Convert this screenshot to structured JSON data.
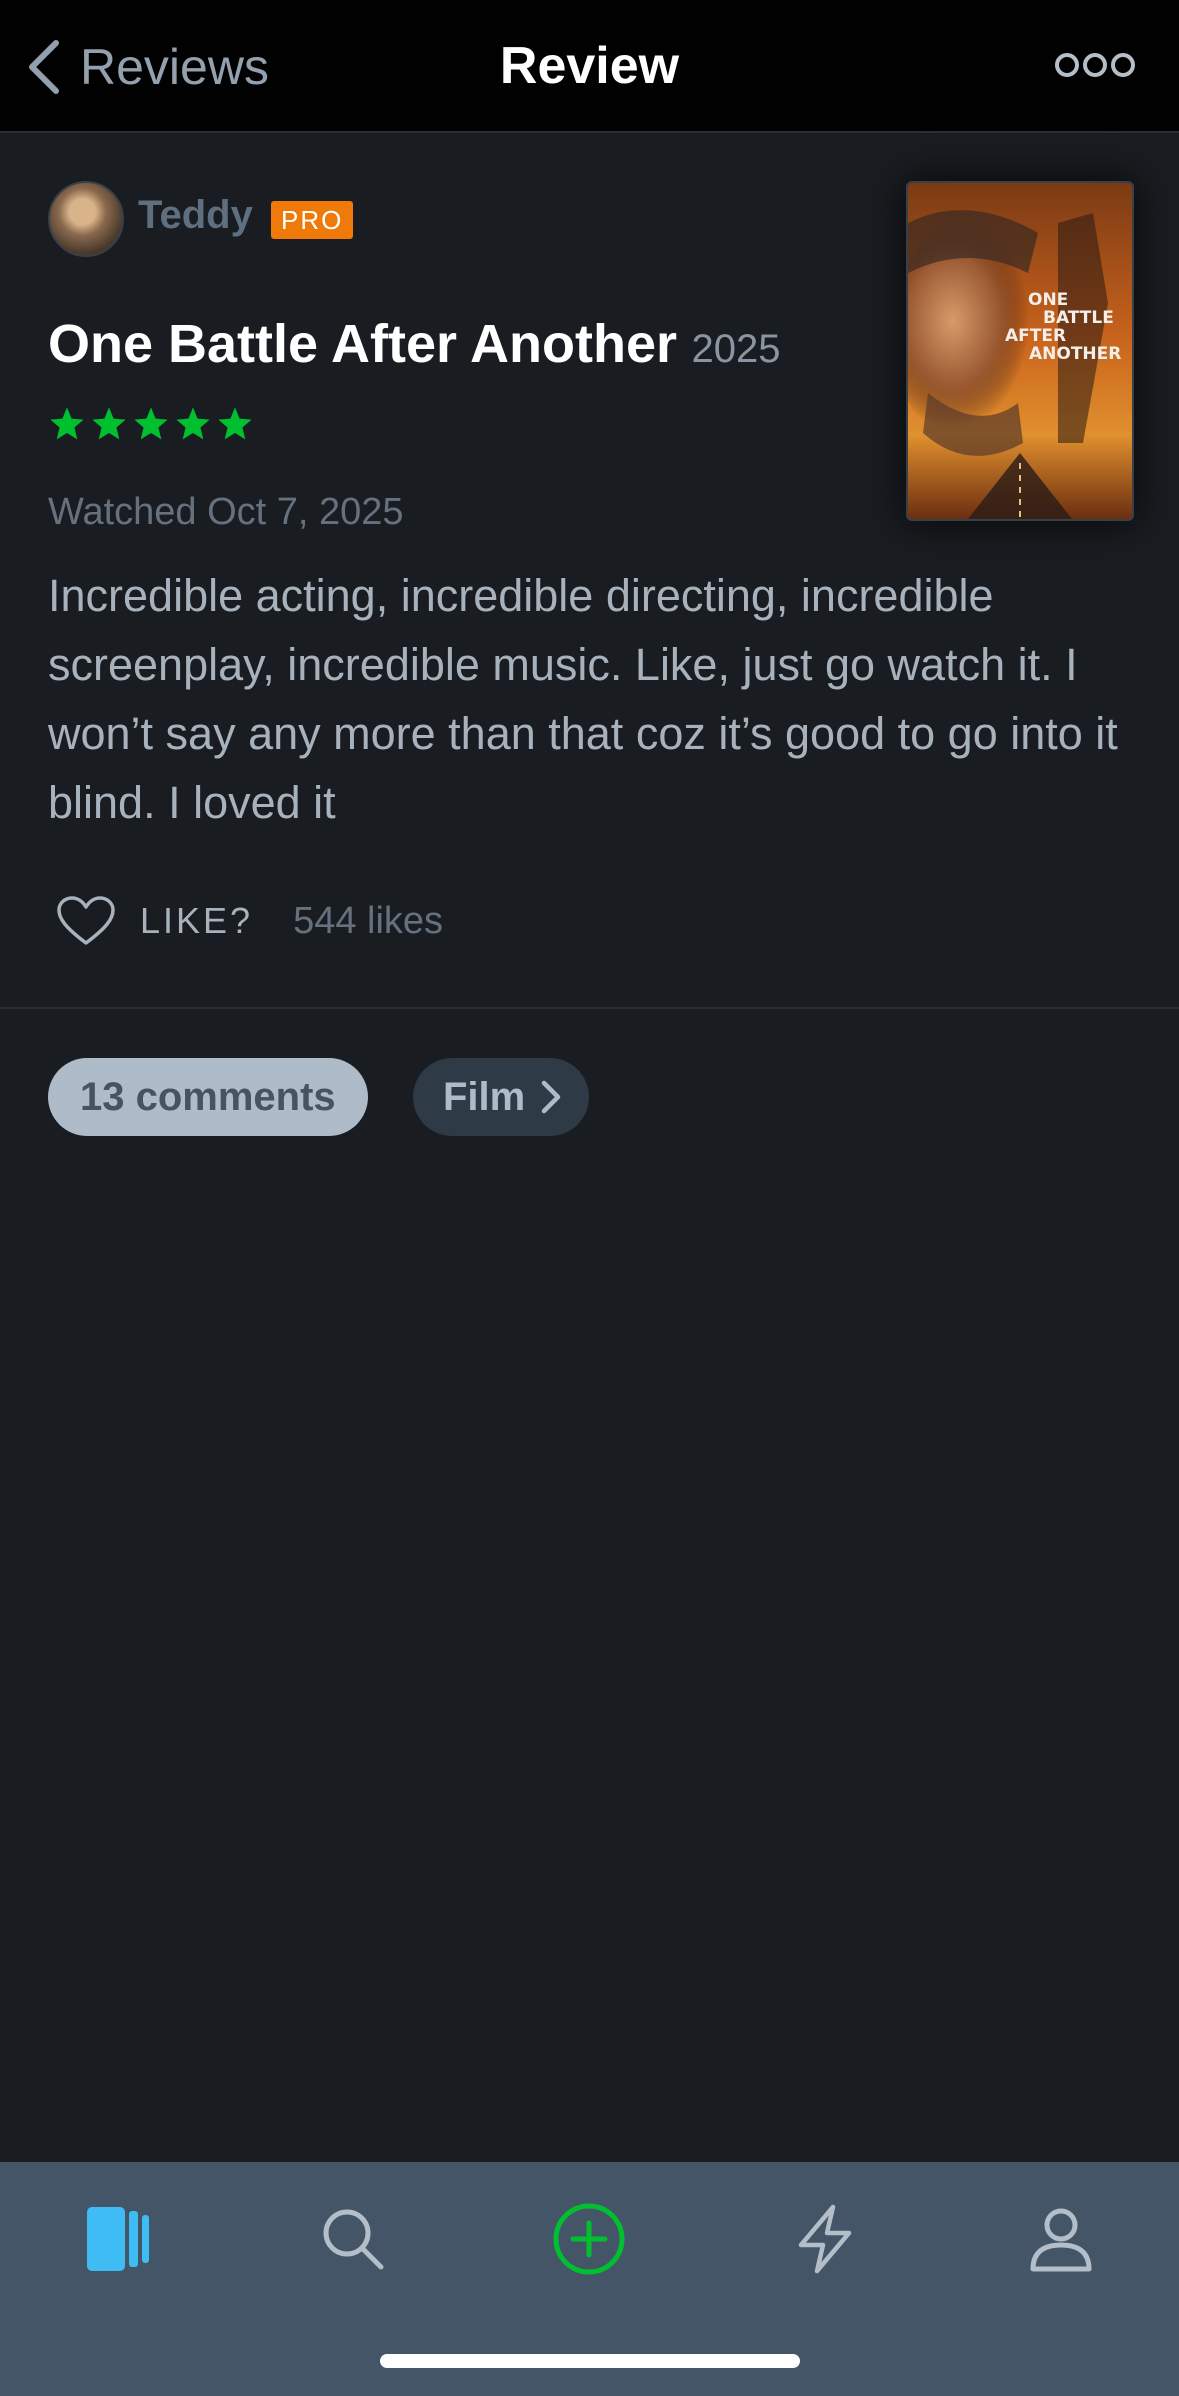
{
  "header": {
    "back_label": "Reviews",
    "title": "Review"
  },
  "review": {
    "username": "Teddy",
    "badge": "PRO",
    "film_title": "One Battle After Another",
    "film_year": "2025",
    "rating_stars": 5,
    "watched": "Watched Oct 7, 2025",
    "text": "Incredible acting, incredible directing, incredible screenplay, incredible music. Like, just go watch it. I won’t say any more than that coz it’s good to go into it blind. I loved it",
    "like_label": "LIKE?",
    "likes_count": "544 likes"
  },
  "poster": {
    "line1": "ONE",
    "line2": "BATTLE",
    "line3": "AFTER",
    "line4": "ANOTHER"
  },
  "pills": {
    "comments": "13 comments",
    "film": "Film"
  },
  "tabbar": {
    "items": [
      "films-icon",
      "search-icon",
      "add-icon",
      "activity-icon",
      "profile-icon"
    ],
    "active": "films-icon"
  },
  "colors": {
    "star_green": "#00c030",
    "pro_orange": "#ef7a0a",
    "active_tab_blue": "#40bcf4",
    "tabbar_bg": "#445567"
  }
}
